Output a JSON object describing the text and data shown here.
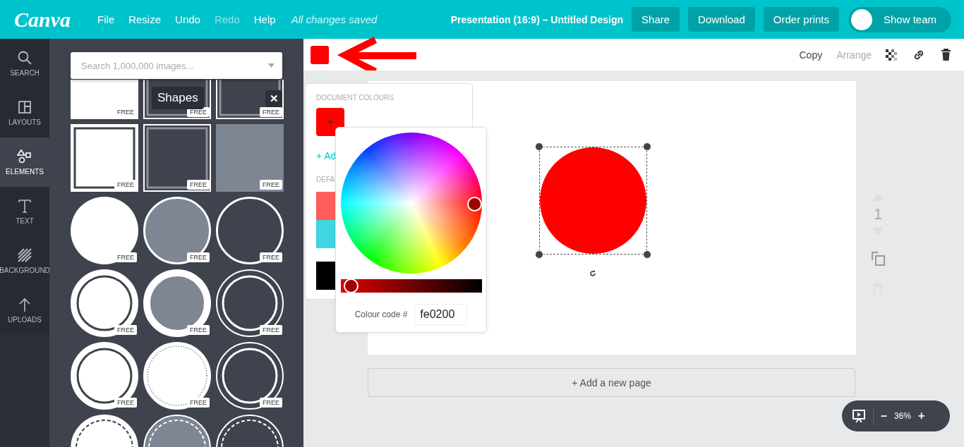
{
  "topbar": {
    "logo": "Canva",
    "menu": [
      {
        "label": "File",
        "disabled": false
      },
      {
        "label": "Resize",
        "disabled": false
      },
      {
        "label": "Undo",
        "disabled": false
      },
      {
        "label": "Redo",
        "disabled": true
      },
      {
        "label": "Help",
        "disabled": false
      }
    ],
    "status": "All changes saved",
    "title": "Presentation (16:9) – Untitled Design",
    "buttons": [
      "Share",
      "Download",
      "Order prints"
    ],
    "team_toggle": {
      "label": "Show team",
      "on": false
    }
  },
  "sidebar": {
    "items": [
      {
        "label": "SEARCH",
        "kind": "search",
        "selected": false
      },
      {
        "label": "LAYOUTS",
        "kind": "layouts",
        "selected": false
      },
      {
        "label": "ELEMENTS",
        "kind": "elements",
        "selected": true
      },
      {
        "label": "TEXT",
        "kind": "text",
        "selected": false
      },
      {
        "label": "BACKGROUND",
        "kind": "background",
        "selected": false
      },
      {
        "label": "UPLOADS",
        "kind": "uploads",
        "selected": false
      }
    ]
  },
  "panel": {
    "search": {
      "placeholder": "Search 1,000,000 images..."
    },
    "tooltip": "Shapes",
    "close": "✕",
    "tiles": [
      {
        "kind": "square",
        "color": "#ffffff",
        "badge": "FREE"
      },
      {
        "kind": "square-frame",
        "color": "#3e434d",
        "badge": "FREE"
      },
      {
        "kind": "square-frame",
        "color": "#3e434d",
        "badge": "FREE"
      },
      {
        "kind": "square-frame",
        "color": "#ffffff",
        "badge": "FREE"
      },
      {
        "kind": "square-frame",
        "color": "#3e434d",
        "badge": "FREE"
      },
      {
        "kind": "square",
        "color": "#7d8692",
        "badge": "FREE"
      },
      {
        "kind": "circle",
        "color": "#ffffff",
        "badge": "FREE"
      },
      {
        "kind": "circle-ring",
        "color": "#7d8692",
        "badge": "FREE"
      },
      {
        "kind": "circle-ring",
        "color": "#3e434d",
        "badge": "FREE"
      },
      {
        "kind": "circle-double",
        "color": "#ffffff",
        "badge": "FREE"
      },
      {
        "kind": "circle-thick",
        "color": "#7d8692",
        "badge": "FREE"
      },
      {
        "kind": "circle-double",
        "color": "#3e434d",
        "badge": "FREE"
      },
      {
        "kind": "circle-double",
        "color": "#ffffff",
        "badge": "FREE"
      },
      {
        "kind": "circle-dotted",
        "color": "#ffffff",
        "badge": "FREE"
      },
      {
        "kind": "circle-double",
        "color": "#3e434d",
        "badge": "FREE"
      },
      {
        "kind": "circle-dashed",
        "color": "#ffffff"
      },
      {
        "kind": "circle-dashed",
        "color": "#7d8692"
      },
      {
        "kind": "circle-dashed",
        "color": "#3e434d"
      }
    ]
  },
  "toolbar": {
    "color": "#fe0200",
    "actions": [
      {
        "label": "Copy",
        "disabled": false
      },
      {
        "label": "Arrange",
        "disabled": true
      }
    ]
  },
  "document_colours": {
    "heading": "DOCUMENT COLOURS",
    "swatches": [
      {
        "color": "#fe0200",
        "mark": "+"
      }
    ],
    "add_link": "+ Ad",
    "default_heading": "DEFA",
    "default_groups": [
      {
        "swatches": [
          {
            "color": "#ff5c5c"
          },
          {
            "color": "#40d5e0"
          }
        ]
      },
      {
        "swatches": [
          {
            "color": "#000000"
          }
        ]
      }
    ]
  },
  "picker": {
    "level": 0.02,
    "label": "Colour code #",
    "value": "fe0200"
  },
  "canvas": {
    "shape": {
      "kind": "circle",
      "color": "#ff0000",
      "selected": true
    },
    "page_number": "1",
    "add_page": "+ Add a new page"
  },
  "zoom": {
    "minus": "–",
    "value": "36%",
    "plus": "+"
  }
}
